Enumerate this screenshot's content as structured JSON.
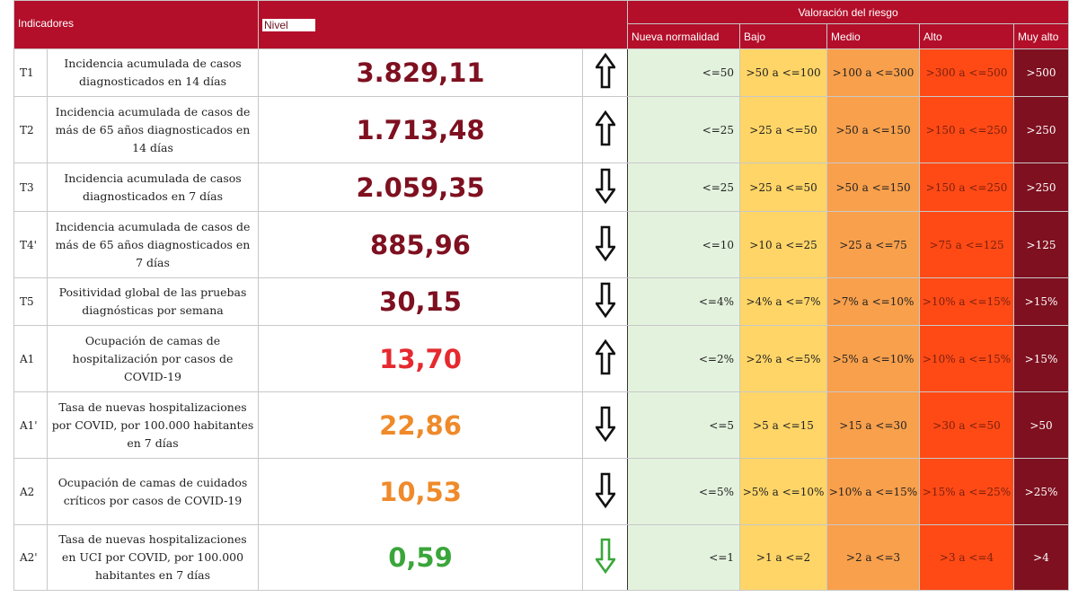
{
  "header": {
    "indicadores": "Indicadores",
    "nivel": "Nivel",
    "valoracion": "Valoración del riesgo",
    "levels": [
      "Nueva normalidad",
      "Bajo",
      "Medio",
      "Alto",
      "Muy alto"
    ]
  },
  "colors": {
    "header": "#b30f2a",
    "nueva_normalidad": "#e3f2dd",
    "bajo": "#ffd567",
    "medio": "#f9a04c",
    "alto": "#ff4a16",
    "muy_alto": "#7e1020"
  },
  "rows": [
    {
      "code": "T1",
      "desc": "Incidencia acumulada de casos diagnosticados en 14 días",
      "value": "3.829,11",
      "value_color": "dark",
      "trend": "up",
      "trend_icon": "arrow-up-icon",
      "ranges": [
        "<=50",
        ">50 a <=100",
        ">100 a <=300",
        ">300 a <=500",
        ">500"
      ]
    },
    {
      "code": "T2",
      "desc": "Incidencia acumulada de casos de más de 65 años diagnosticados en 14 días",
      "value": "1.713,48",
      "value_color": "dark",
      "trend": "up",
      "trend_icon": "arrow-up-icon",
      "ranges": [
        "<=25",
        ">25 a <=50",
        ">50 a <=150",
        ">150 a <=250",
        ">250"
      ]
    },
    {
      "code": "T3",
      "desc": "Incidencia acumulada de casos diagnosticados en 7 días",
      "value": "2.059,35",
      "value_color": "dark",
      "trend": "down",
      "trend_icon": "arrow-down-icon",
      "ranges": [
        "<=25",
        ">25 a <=50",
        ">50 a <=150",
        ">150 a <=250",
        ">250"
      ]
    },
    {
      "code": "T4'",
      "desc": "Incidencia acumulada de casos de más de 65 años diagnosticados en 7 días",
      "value": "885,96",
      "value_color": "dark",
      "trend": "down",
      "trend_icon": "arrow-down-icon",
      "ranges": [
        "<=10",
        ">10 a <=25",
        ">25 a <=75",
        ">75 a <=125",
        ">125"
      ]
    },
    {
      "code": "T5",
      "desc": "Positividad global de las pruebas diagnósticas por semana",
      "value": "30,15",
      "value_color": "dark",
      "trend": "down",
      "trend_icon": "arrow-down-icon",
      "ranges": [
        "<=4%",
        ">4% a <=7%",
        ">7% a <=10%",
        ">10% a <=15%",
        ">15%"
      ]
    },
    {
      "code": "A1",
      "desc": "Ocupación de camas de hospitalización por casos de COVID-19",
      "value": "13,70",
      "value_color": "red",
      "trend": "up",
      "trend_icon": "arrow-up-icon",
      "ranges": [
        "<=2%",
        ">2% a <=5%",
        ">5% a <=10%",
        ">10% a <=15%",
        ">15%"
      ]
    },
    {
      "code": "A1'",
      "desc": "Tasa de nuevas hospitalizaciones por COVID, por 100.000 habitantes en 7 días",
      "value": "22,86",
      "value_color": "orange",
      "trend": "down",
      "trend_icon": "arrow-down-icon",
      "ranges": [
        "<=5",
        ">5 a <=15",
        ">15 a <=30",
        ">30 a <=50",
        ">50"
      ]
    },
    {
      "code": "A2",
      "desc": "Ocupación de camas de cuidados críticos por casos de COVID-19",
      "value": "10,53",
      "value_color": "orange",
      "trend": "down",
      "trend_icon": "arrow-down-icon",
      "ranges": [
        "<=5%",
        ">5% a <=10%",
        ">10% a <=15%",
        ">15% a <=25%",
        ">25%"
      ]
    },
    {
      "code": "A2'",
      "desc": "Tasa de nuevas hospitalizaciones en UCI por COVID, por 100.000 habitantes en 7 días",
      "value": "0,59",
      "value_color": "green",
      "trend": "down",
      "trend_icon": "arrow-down-green-icon",
      "ranges": [
        "<=1",
        ">1 a <=2",
        ">2 a <=3",
        ">3 a <=4",
        ">4"
      ]
    }
  ]
}
